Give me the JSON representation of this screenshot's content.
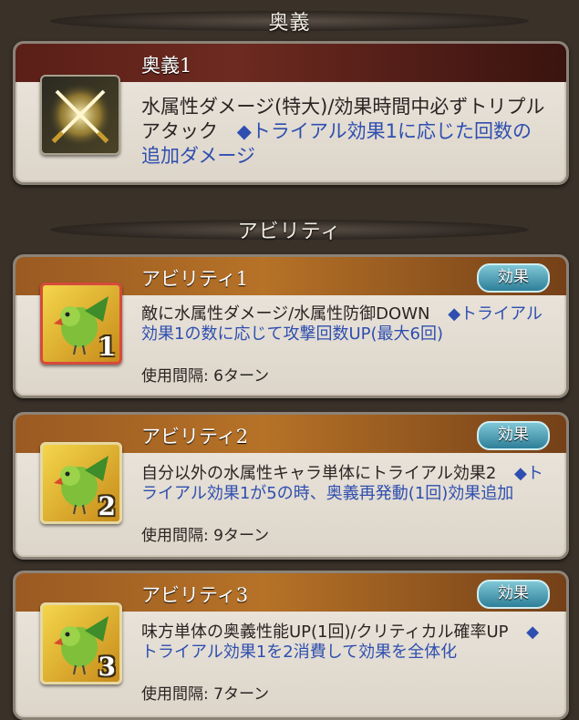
{
  "sections": {
    "ougi_title": "奥義",
    "ability_title": "アビリティ"
  },
  "ougi": {
    "name": "奥義1",
    "description_main": "水属性ダメージ(特大)/効果時間中必ずトリプルアタック",
    "description_trial": "◆トライアル効果1に応じた回数の追加ダメージ",
    "icon": "crossed-swords-icon"
  },
  "abilities": [
    {
      "name": "アビリティ1",
      "effect_button": "効果",
      "description_main": "敵に水属性ダメージ/水属性防御DOWN",
      "description_trial": "◆トライアル効果1の数に応じて攻撃回数UP(最大6回)",
      "interval": "使用間隔: 6ターン",
      "level": "1",
      "icon": "parrot-icon"
    },
    {
      "name": "アビリティ2",
      "effect_button": "効果",
      "description_main": "自分以外の水属性キャラ単体にトライアル効果2",
      "description_trial": "◆トライアル効果1が5の時、奥義再発動(1回)効果追加",
      "interval": "使用間隔: 9ターン",
      "level": "2",
      "icon": "parrot-icon"
    },
    {
      "name": "アビリティ3",
      "effect_button": "効果",
      "description_main": "味方単体の奥義性能UP(1回)/クリティカル確率UP",
      "description_trial": "◆トライアル効果1を2消費して効果を全体化",
      "interval": "使用間隔: 7ターン",
      "level": "3",
      "icon": "parrot-icon"
    }
  ],
  "colors": {
    "trial_text": "#2e4fb0",
    "ougi_header": "#5a1f18",
    "ability_header": "#9a5a22",
    "effect_button": "#2d7f98"
  }
}
